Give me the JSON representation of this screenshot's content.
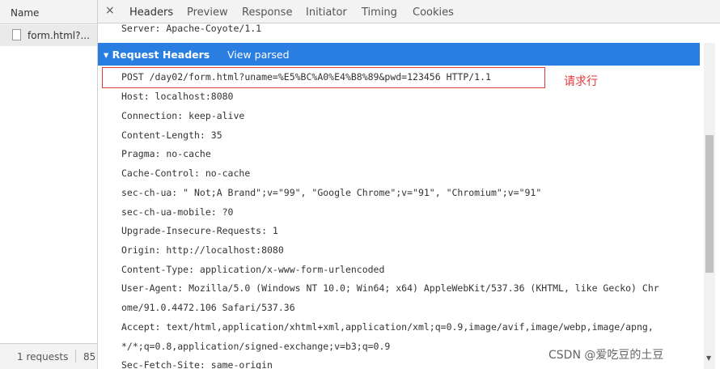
{
  "request_list": {
    "column_header": "Name",
    "items": [
      {
        "name": "form.html?..."
      }
    ],
    "footer": {
      "requests": "1 requests",
      "transferred": "85"
    }
  },
  "detail": {
    "tabs": [
      {
        "label": "Headers",
        "active": true
      },
      {
        "label": "Preview",
        "active": false
      },
      {
        "label": "Response",
        "active": false
      },
      {
        "label": "Initiator",
        "active": false
      },
      {
        "label": "Timing",
        "active": false
      },
      {
        "label": "Cookies",
        "active": false
      }
    ],
    "close_icon": "×",
    "server_line": "Server: Apache-Coyote/1.1",
    "section": {
      "title": "▾ Request Headers",
      "view_parsed": "View parsed"
    },
    "request_line": "POST /day02/form.html?uname=%E5%BC%A0%E4%B8%89&pwd=123456 HTTP/1.1",
    "annotation": "请求行",
    "headers": [
      "Host: localhost:8080",
      "Connection: keep-alive",
      "Content-Length: 35",
      "Pragma: no-cache",
      "Cache-Control: no-cache",
      "sec-ch-ua: \" Not;A Brand\";v=\"99\", \"Google Chrome\";v=\"91\", \"Chromium\";v=\"91\"",
      "sec-ch-ua-mobile: ?0",
      "Upgrade-Insecure-Requests: 1",
      "Origin: http://localhost:8080",
      "Content-Type: application/x-www-form-urlencoded",
      "User-Agent: Mozilla/5.0 (Windows NT 10.0; Win64; x64) AppleWebKit/537.36 (KHTML, like Gecko) Chr",
      "ome/91.0.4472.106 Safari/537.36",
      "Accept: text/html,application/xhtml+xml,application/xml;q=0.9,image/avif,image/webp,image/apng,",
      "*/*;q=0.8,application/signed-exchange;v=b3;q=0.9",
      "Sec-Fetch-Site: same-origin"
    ]
  },
  "colors": {
    "section_bar": "#2a7de1",
    "annotation": "#e23a3a"
  },
  "watermark": "CSDN @爱吃豆的土豆"
}
